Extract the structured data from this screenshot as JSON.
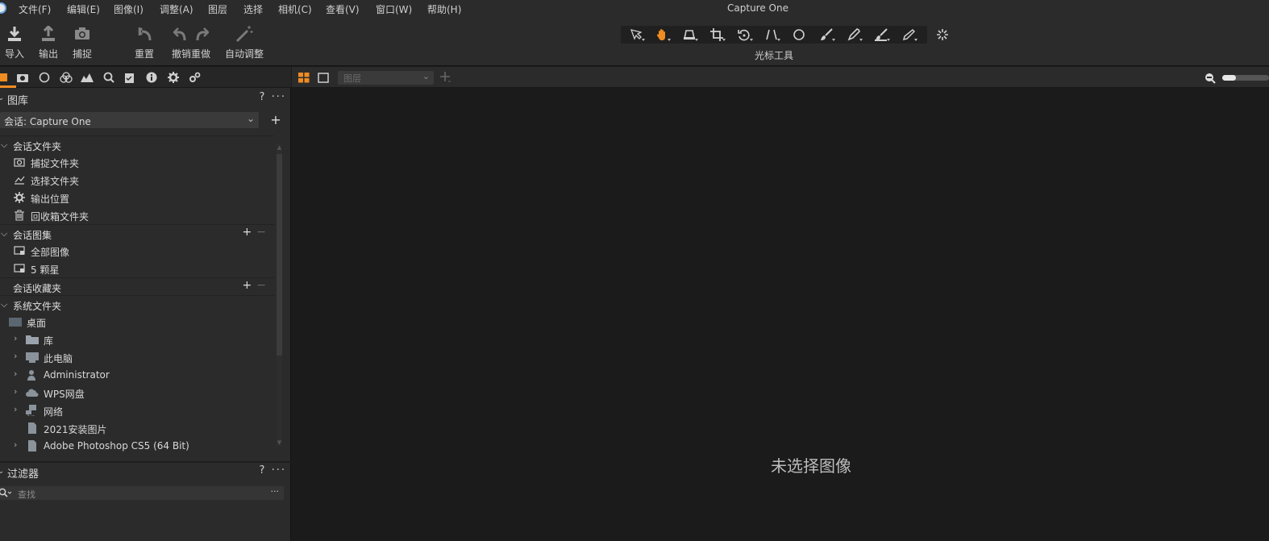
{
  "app": {
    "title": "Capture One"
  },
  "menu": [
    "文件(F)",
    "编辑(E)",
    "图像(I)",
    "调整(A)",
    "图层",
    "选择",
    "相机(C)",
    "查看(V)",
    "窗口(W)",
    "帮助(H)"
  ],
  "toolbar": {
    "import": "导入",
    "export": "输出",
    "capture": "捕捉",
    "reset": "重置",
    "undo_redo": "撤销重做",
    "auto_adjust": "自动调整",
    "cursor_tools_label": "光标工具"
  },
  "cursor_tools": [
    "select-arrow-icon",
    "hand-pan-icon",
    "keystone-icon",
    "crop-icon",
    "rotate-icon",
    "straighten-icon",
    "circle-mask-icon",
    "brush-icon",
    "picker-icon",
    "eraser-brush-icon",
    "pencil-icon",
    "spinner-icon"
  ],
  "accent_color": "#ef8c22",
  "library": {
    "title": "图库",
    "help": "?",
    "more": "···",
    "session": "会话: Capture One",
    "add": "+",
    "session_folders": {
      "title": "会话文件夹",
      "items": [
        "捕捉文件夹",
        "选择文件夹",
        "输出位置",
        "回收箱文件夹"
      ]
    },
    "session_albums": {
      "title": "会话图集",
      "items": [
        "全部图像",
        "5 颗星"
      ]
    },
    "session_favorites": {
      "title": "会话收藏夹"
    },
    "system_folders": {
      "title": "系统文件夹",
      "items": [
        "桌面",
        "库",
        "此电脑",
        "Administrator",
        "WPS网盘",
        "网络",
        "2021安装图片",
        "Adobe Photoshop CS5 (64 Bit)"
      ]
    }
  },
  "filters": {
    "title": "过滤器",
    "search_placeholder": "查找",
    "more": "···"
  },
  "viewer": {
    "layer_placeholder": "图层",
    "empty_message": "未选择图像",
    "zoom_level": 0.3
  }
}
